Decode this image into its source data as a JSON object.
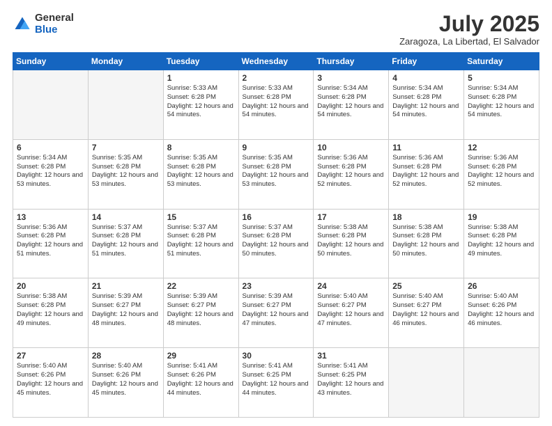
{
  "header": {
    "logo_general": "General",
    "logo_blue": "Blue",
    "month_title": "July 2025",
    "location": "Zaragoza, La Libertad, El Salvador"
  },
  "days_of_week": [
    "Sunday",
    "Monday",
    "Tuesday",
    "Wednesday",
    "Thursday",
    "Friday",
    "Saturday"
  ],
  "weeks": [
    [
      {
        "day": "",
        "info": ""
      },
      {
        "day": "",
        "info": ""
      },
      {
        "day": "1",
        "info": "Sunrise: 5:33 AM\nSunset: 6:28 PM\nDaylight: 12 hours and 54 minutes."
      },
      {
        "day": "2",
        "info": "Sunrise: 5:33 AM\nSunset: 6:28 PM\nDaylight: 12 hours and 54 minutes."
      },
      {
        "day": "3",
        "info": "Sunrise: 5:34 AM\nSunset: 6:28 PM\nDaylight: 12 hours and 54 minutes."
      },
      {
        "day": "4",
        "info": "Sunrise: 5:34 AM\nSunset: 6:28 PM\nDaylight: 12 hours and 54 minutes."
      },
      {
        "day": "5",
        "info": "Sunrise: 5:34 AM\nSunset: 6:28 PM\nDaylight: 12 hours and 54 minutes."
      }
    ],
    [
      {
        "day": "6",
        "info": "Sunrise: 5:34 AM\nSunset: 6:28 PM\nDaylight: 12 hours and 53 minutes."
      },
      {
        "day": "7",
        "info": "Sunrise: 5:35 AM\nSunset: 6:28 PM\nDaylight: 12 hours and 53 minutes."
      },
      {
        "day": "8",
        "info": "Sunrise: 5:35 AM\nSunset: 6:28 PM\nDaylight: 12 hours and 53 minutes."
      },
      {
        "day": "9",
        "info": "Sunrise: 5:35 AM\nSunset: 6:28 PM\nDaylight: 12 hours and 53 minutes."
      },
      {
        "day": "10",
        "info": "Sunrise: 5:36 AM\nSunset: 6:28 PM\nDaylight: 12 hours and 52 minutes."
      },
      {
        "day": "11",
        "info": "Sunrise: 5:36 AM\nSunset: 6:28 PM\nDaylight: 12 hours and 52 minutes."
      },
      {
        "day": "12",
        "info": "Sunrise: 5:36 AM\nSunset: 6:28 PM\nDaylight: 12 hours and 52 minutes."
      }
    ],
    [
      {
        "day": "13",
        "info": "Sunrise: 5:36 AM\nSunset: 6:28 PM\nDaylight: 12 hours and 51 minutes."
      },
      {
        "day": "14",
        "info": "Sunrise: 5:37 AM\nSunset: 6:28 PM\nDaylight: 12 hours and 51 minutes."
      },
      {
        "day": "15",
        "info": "Sunrise: 5:37 AM\nSunset: 6:28 PM\nDaylight: 12 hours and 51 minutes."
      },
      {
        "day": "16",
        "info": "Sunrise: 5:37 AM\nSunset: 6:28 PM\nDaylight: 12 hours and 50 minutes."
      },
      {
        "day": "17",
        "info": "Sunrise: 5:38 AM\nSunset: 6:28 PM\nDaylight: 12 hours and 50 minutes."
      },
      {
        "day": "18",
        "info": "Sunrise: 5:38 AM\nSunset: 6:28 PM\nDaylight: 12 hours and 50 minutes."
      },
      {
        "day": "19",
        "info": "Sunrise: 5:38 AM\nSunset: 6:28 PM\nDaylight: 12 hours and 49 minutes."
      }
    ],
    [
      {
        "day": "20",
        "info": "Sunrise: 5:38 AM\nSunset: 6:28 PM\nDaylight: 12 hours and 49 minutes."
      },
      {
        "day": "21",
        "info": "Sunrise: 5:39 AM\nSunset: 6:27 PM\nDaylight: 12 hours and 48 minutes."
      },
      {
        "day": "22",
        "info": "Sunrise: 5:39 AM\nSunset: 6:27 PM\nDaylight: 12 hours and 48 minutes."
      },
      {
        "day": "23",
        "info": "Sunrise: 5:39 AM\nSunset: 6:27 PM\nDaylight: 12 hours and 47 minutes."
      },
      {
        "day": "24",
        "info": "Sunrise: 5:40 AM\nSunset: 6:27 PM\nDaylight: 12 hours and 47 minutes."
      },
      {
        "day": "25",
        "info": "Sunrise: 5:40 AM\nSunset: 6:27 PM\nDaylight: 12 hours and 46 minutes."
      },
      {
        "day": "26",
        "info": "Sunrise: 5:40 AM\nSunset: 6:26 PM\nDaylight: 12 hours and 46 minutes."
      }
    ],
    [
      {
        "day": "27",
        "info": "Sunrise: 5:40 AM\nSunset: 6:26 PM\nDaylight: 12 hours and 45 minutes."
      },
      {
        "day": "28",
        "info": "Sunrise: 5:40 AM\nSunset: 6:26 PM\nDaylight: 12 hours and 45 minutes."
      },
      {
        "day": "29",
        "info": "Sunrise: 5:41 AM\nSunset: 6:26 PM\nDaylight: 12 hours and 44 minutes."
      },
      {
        "day": "30",
        "info": "Sunrise: 5:41 AM\nSunset: 6:25 PM\nDaylight: 12 hours and 44 minutes."
      },
      {
        "day": "31",
        "info": "Sunrise: 5:41 AM\nSunset: 6:25 PM\nDaylight: 12 hours and 43 minutes."
      },
      {
        "day": "",
        "info": ""
      },
      {
        "day": "",
        "info": ""
      }
    ]
  ]
}
